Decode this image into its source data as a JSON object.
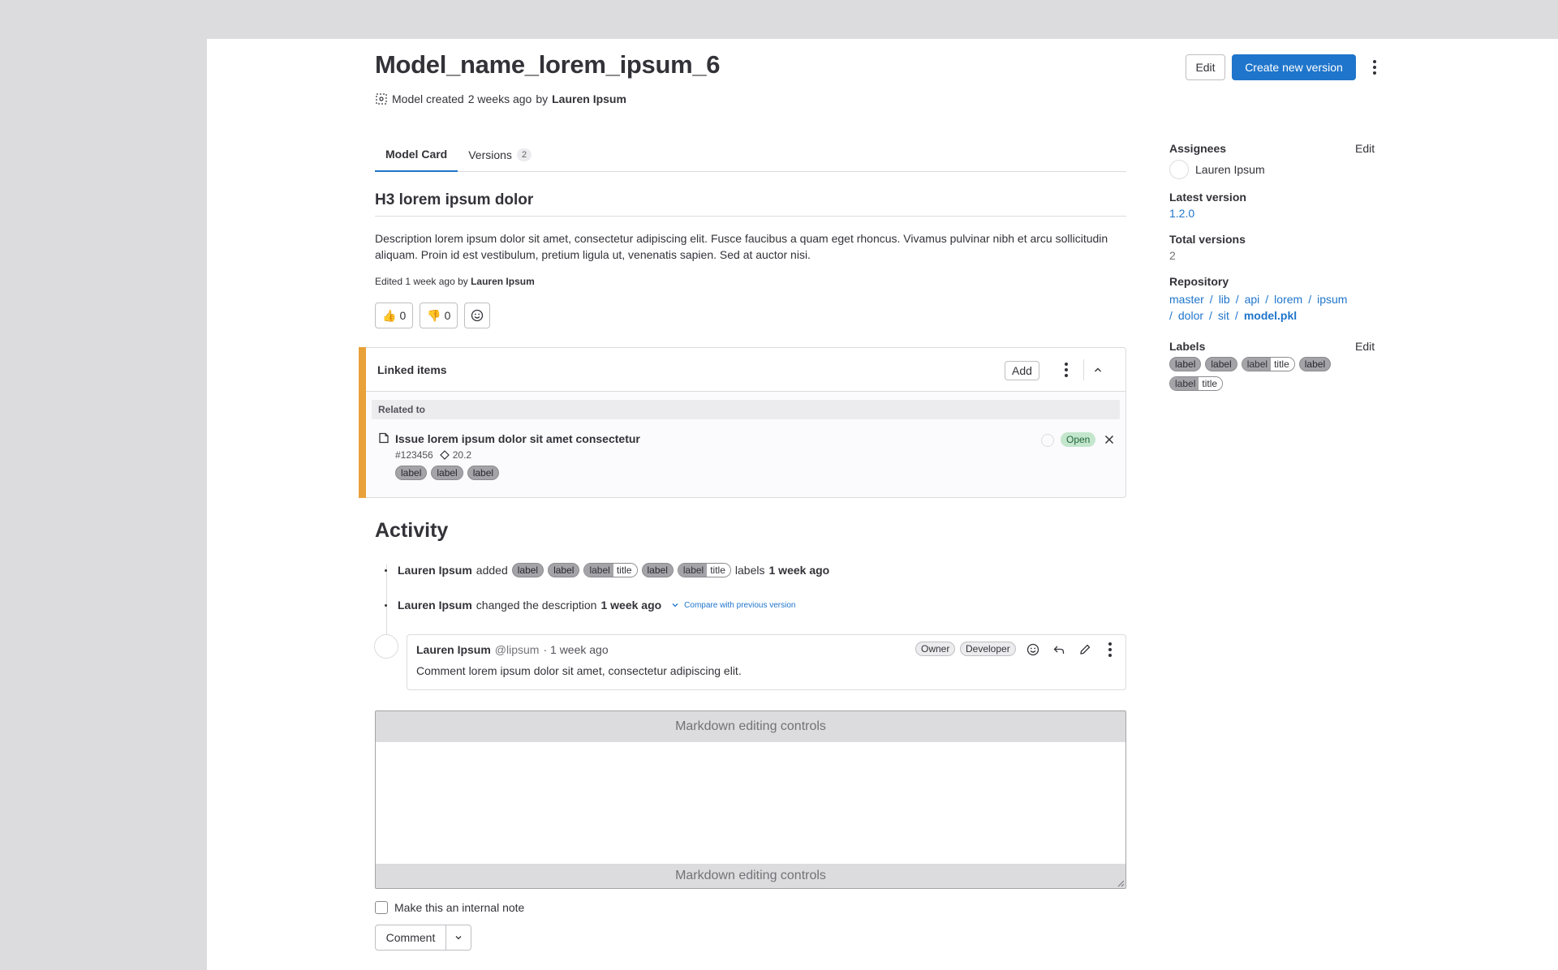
{
  "header": {
    "title": "Model_name_lorem_ipsum_6",
    "subtitle_prefix": "Model created",
    "subtitle_time": "2 weeks ago",
    "subtitle_by": "by",
    "author": "Lauren Ipsum",
    "edit_label": "Edit",
    "create_label": "Create new version"
  },
  "tabs": [
    {
      "label": "Model Card",
      "active": true
    },
    {
      "label": "Versions",
      "count": "2"
    }
  ],
  "card": {
    "heading": "H3 lorem ipsum dolor",
    "description": "Description lorem ipsum dolor sit amet, consectetur adipiscing elit. Fusce faucibus a quam eget rhoncus. Vivamus pulvinar nibh et arcu sollicitudin aliquam. Proin id est vestibulum, pretium ligula ut, venenatis sapien. Sed at auctor nisi.",
    "edited_prefix": "Edited 1 week ago by",
    "edited_by": "Lauren Ipsum",
    "thumbs_up": "0",
    "thumbs_down": "0"
  },
  "linked": {
    "title": "Linked items",
    "add_label": "Add",
    "section": "Related to",
    "item": {
      "title": "Issue lorem ipsum dolor sit amet consectetur",
      "ref": "#123456",
      "milestone": "20.2",
      "status": "Open",
      "labels": [
        "label",
        "label",
        "label"
      ]
    }
  },
  "activity": {
    "title": "Activity",
    "event1": {
      "author": "Lauren Ipsum",
      "action": "added",
      "labels": [
        {
          "text": "label"
        },
        {
          "text": "label"
        },
        {
          "text": "label",
          "scope": "title"
        },
        {
          "text": "label"
        },
        {
          "text": "label",
          "scope": "title"
        }
      ],
      "suffix": "labels",
      "time": "1 week ago"
    },
    "event2": {
      "author": "Lauren Ipsum",
      "action": "changed the description",
      "time": "1 week ago",
      "compare": "Compare with previous version"
    },
    "comment": {
      "author": "Lauren Ipsum",
      "handle": "@lipsum",
      "time": "· 1 week ago",
      "role1": "Owner",
      "role2": "Developer",
      "body": "Comment lorem ipsum dolor sit amet, consectetur adipiscing elit."
    }
  },
  "editor": {
    "top_bar": "Markdown editing controls",
    "bottom_bar": "Markdown editing controls",
    "internal_note": "Make this an internal note",
    "comment_label": "Comment"
  },
  "sidebar": {
    "assignees_title": "Assignees",
    "assignees_edit": "Edit",
    "assignee": "Lauren Ipsum",
    "latest_title": "Latest version",
    "latest_value": "1.2.0",
    "total_title": "Total versions",
    "total_value": "2",
    "repo_title": "Repository",
    "repo_path": [
      "master",
      "lib",
      "api",
      "lorem",
      "ipsum",
      "dolor",
      "sit"
    ],
    "repo_file": "model.pkl",
    "labels_title": "Labels",
    "labels_edit": "Edit",
    "labels": [
      {
        "text": "label"
      },
      {
        "text": "label"
      },
      {
        "text": "label",
        "scope": "title"
      },
      {
        "text": "label"
      },
      {
        "text": "label",
        "scope": "title"
      }
    ]
  },
  "colors": {
    "accent": "#1f75cb",
    "linked_border": "#e9a13a",
    "open_badge": "#c3e6cd"
  }
}
